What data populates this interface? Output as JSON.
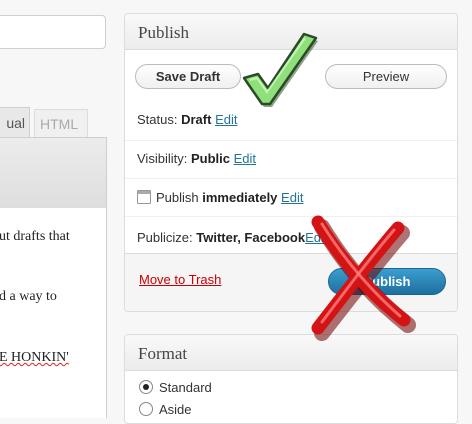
{
  "editor": {
    "tabs": {
      "visual": "ual",
      "html": "HTML"
    },
    "lines": [
      "ut drafts that",
      "d a way to",
      "E HONKIN'"
    ]
  },
  "publish": {
    "title": "Publish",
    "save_draft": "Save Draft",
    "preview": "Preview",
    "status_label": "Status:",
    "status_value": "Draft",
    "visibility_label": "Visibility:",
    "visibility_value": "Public",
    "schedule_label": "Publish",
    "schedule_value": "immediately",
    "publicize_label": "Publicize:",
    "publicize_value": "Twitter, Facebook",
    "edit": "Edit",
    "trash": "Move to Trash",
    "publish_button": "Publish"
  },
  "format": {
    "title": "Format",
    "options": [
      "Standard",
      "Aside"
    ],
    "selected": "Standard"
  },
  "colors": {
    "link": "#21759b",
    "trash": "#cc0000",
    "publish_button": "#2a86bf",
    "check_mark": "#8fe07a",
    "cross_mark": "#d41414"
  }
}
